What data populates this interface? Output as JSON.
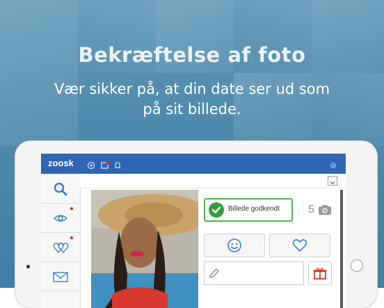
{
  "promo": {
    "title": "Bekræftelse af foto",
    "subtitle_line1": "Vær sikker på, at din date ser ud som",
    "subtitle_line2": "på sit billede."
  },
  "app": {
    "logo": "zoosk",
    "topbar_icons": [
      "coins-icon",
      "messages-icon",
      "bell-icon",
      "settings-icon"
    ],
    "notification_count": "1",
    "sidebar_items": [
      "search-icon",
      "eye-icon",
      "hearts-icon",
      "mail-icon"
    ],
    "verified_badge_label": "Billede godkendt",
    "photo_count": "5",
    "action_buttons": [
      "smile-icon",
      "heart-icon"
    ],
    "gift_icon": "gift-icon",
    "pencil_icon": "pencil-icon"
  },
  "colors": {
    "background": "#4d8aad",
    "topbar": "#2f66b3",
    "verified_green": "#2e9e3a",
    "icon_blue": "#3d7cc9",
    "gift_red": "#d9342b"
  }
}
